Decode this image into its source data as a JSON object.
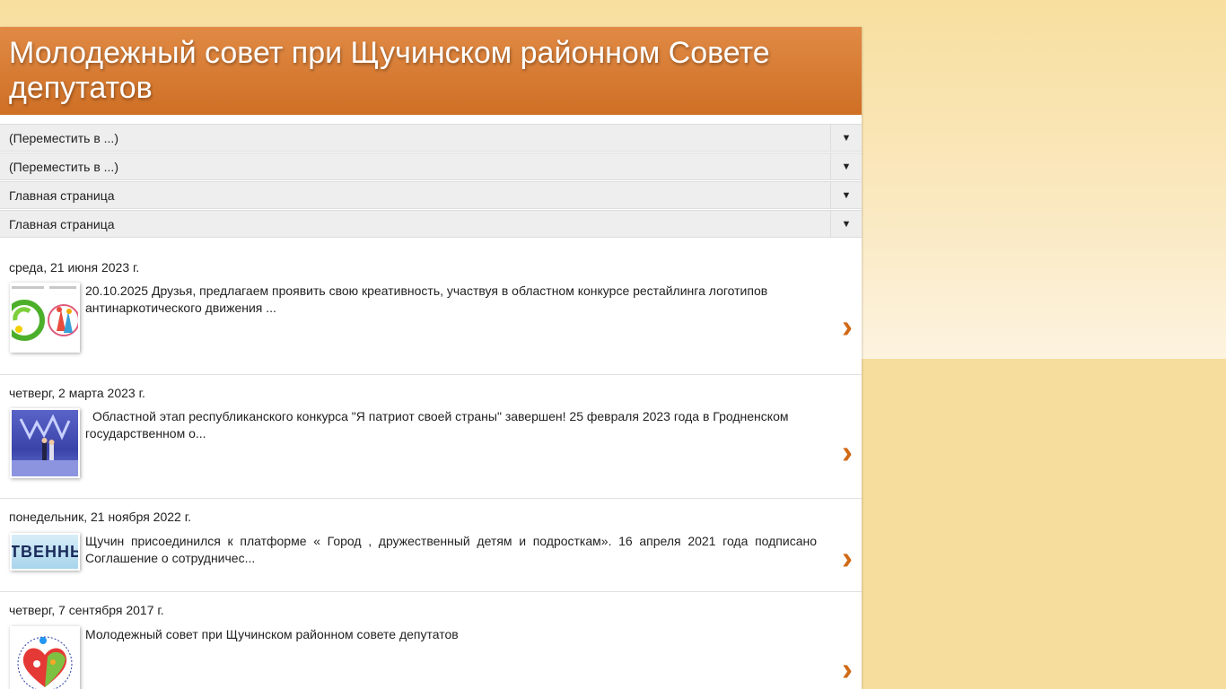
{
  "site": {
    "title": "Молодежный совет при Щучинском районном Совете депутатов"
  },
  "nav": [
    {
      "label": "(Переместить в ...)",
      "arrow": "▼"
    },
    {
      "label": "(Переместить в ...)",
      "arrow": "▼"
    },
    {
      "label": "Главная страница",
      "arrow": "▼"
    },
    {
      "label": "Главная страница",
      "arrow": "▼"
    }
  ],
  "posts": [
    {
      "date": "среда, 21 июня 2023 г.",
      "snippet": "20.10.2025 Друзья, предлагаем проявить свою креативность, участвуя в областном конкурсе рестайлинга логотипов антинаркотического движения ...",
      "chevron": "›"
    },
    {
      "date": "четверг, 2 марта 2023 г.",
      "snippet": "Областной этап республиканского конкурса \"Я патриот своей страны\" завершен! 25 февраля 2023 года в Гродненском государственном о...",
      "chevron": "›"
    },
    {
      "date": "понедельник, 21 ноября 2022 г.",
      "snippet": "Щучин присоединился к платформе « Город , дружественный детям и подросткам». 16 апреля 2021 года подписано Соглашение о сотрудничес...",
      "thumb_text": "ТВЕННЫ",
      "chevron": "›"
    },
    {
      "date": "четверг, 7 сентября 2017 г.",
      "snippet": "Молодежный совет при Щучинском районном совете депутатов",
      "chevron": "›"
    }
  ],
  "colors": {
    "accent": "#d06a17",
    "header_top": "#e08a45",
    "header_bottom": "#cf6f25",
    "background": "#f7dd9d"
  },
  "icons": {
    "dropdown": "triangle-down-icon",
    "next": "chevron-right-icon"
  }
}
